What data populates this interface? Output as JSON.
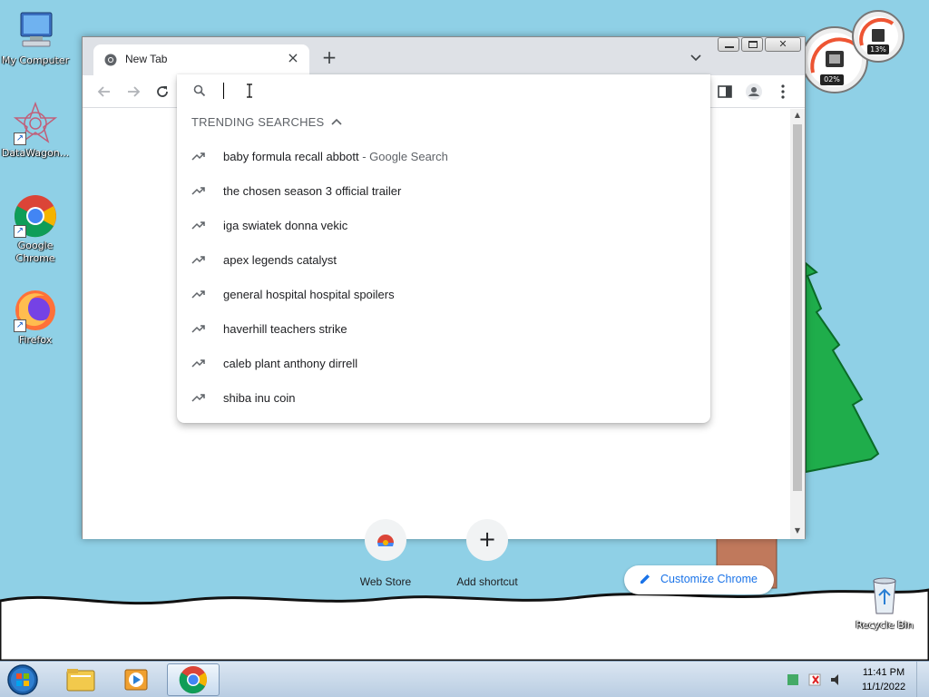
{
  "desktop": {
    "icons": [
      {
        "label": "My Computer",
        "icon": "computer-icon"
      },
      {
        "label": "DataWagon...",
        "icon": "datawagon-icon"
      },
      {
        "label": "Google Chrome",
        "icon": "chrome-icon"
      },
      {
        "label": "Firefox",
        "icon": "firefox-icon"
      },
      {
        "label": "Recycle Bin",
        "icon": "recycle-bin-icon"
      }
    ],
    "gadget": {
      "cpu": "02%",
      "memory": "13%"
    }
  },
  "browser": {
    "tab": {
      "title": "New Tab"
    },
    "omnibox": {
      "value": "",
      "section_header": "TRENDING SEARCHES",
      "suggestions": [
        {
          "query": "baby formula recall abbott",
          "suffix": " - Google Search"
        },
        {
          "query": "the chosen season 3 official trailer",
          "suffix": ""
        },
        {
          "query": "iga swiatek donna vekic",
          "suffix": ""
        },
        {
          "query": "apex legends catalyst",
          "suffix": ""
        },
        {
          "query": "general hospital hospital spoilers",
          "suffix": ""
        },
        {
          "query": "haverhill teachers strike",
          "suffix": ""
        },
        {
          "query": "caleb plant anthony dirrell",
          "suffix": ""
        },
        {
          "query": "shiba inu coin",
          "suffix": ""
        }
      ]
    },
    "shortcuts": [
      {
        "name": "Web Store",
        "icon": "web-store-icon"
      },
      {
        "name": "Add shortcut",
        "icon": "plus-icon"
      }
    ],
    "customize_label": "Customize Chrome"
  },
  "taskbar": {
    "time": "11:41 PM",
    "date": "11/1/2022"
  },
  "colors": {
    "sky": "#8fd0e6",
    "accent": "#1a73e8",
    "tab_strip": "#dee1e6"
  }
}
